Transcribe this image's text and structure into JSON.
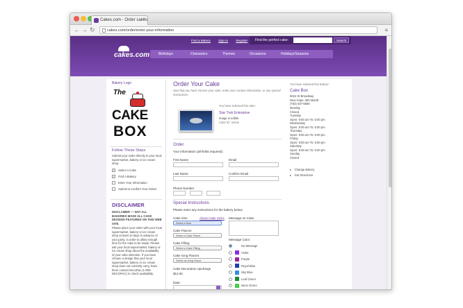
{
  "browser": {
    "tab_title": "Cakes.com - Order cakes",
    "url": "cakes.com/order/enter-your-information"
  },
  "header": {
    "logo_text": "cakes.com",
    "top_links": [
      "Find a Bakery",
      "Sign In",
      "Register"
    ],
    "search_label": "Find the perfect cake:",
    "search_button": "Search",
    "nav": [
      "Birthdays",
      "Characters",
      "Themes",
      "Occasions",
      "Holidays/Seasons"
    ]
  },
  "sidebar": {
    "bakery_logo_label": "Bakery Logo",
    "logo_the": "The",
    "logo_cake": "CAKE",
    "logo_box": "BOX",
    "steps_title": "Follow These Steps",
    "steps_intro": "Submit your order directly to your local supermarket, bakery or ice cream shop.",
    "steps": [
      {
        "label": "Select A Cake",
        "done": true
      },
      {
        "label": "Find A Bakery",
        "done": true
      },
      {
        "label": "Enter Your Information",
        "done": false
      },
      {
        "label": "Submit & Confirm Your Order!",
        "done": false
      }
    ],
    "disclaimer_title": "DISCLAIMER",
    "disclaimer_bold": "DISCLAIMER — NOT ALL BAKERIES MAKE ALL CAKE DESIGNS FEATURED ON THIS WEB SITE.",
    "disclaimer_text": "Please place your order with your local supermarket, bakery or ice cream shop at least 10 days in advance of your party, in order to allow enough time for the cake to be made. Please ask your local supermarket, bakery or ice cream shop about the availability of your cake selection. If you have chosen a design that your local supermarket, bakery or ice cream shop does not currently carry, have them contact DecoPac (1-800-DECOPAC) to check availability."
  },
  "main": {
    "title": "Order Your Cake",
    "intro": "Now that you have chosen your cake, enter your contact information, or any special instructions.",
    "selected_label": "You have selected this cake:",
    "cake_name": "Star Trek Enterprise",
    "cake_note": "Image is edible.",
    "cake_id": "Cake ID: 44442",
    "order_title": "Order",
    "info_required": "Your information (all fields required):",
    "first_name_label": "First Name",
    "email_label": "Email",
    "last_name_label": "Last Name",
    "confirm_email_label": "Confirm Email",
    "phone_label": "Phone Number",
    "special_title": "Special Instructions",
    "special_intro": "Please enter any instructions for the bakery below.",
    "cake_size_label": "Cake Size",
    "about_sizes": "About Cake Sizes",
    "cake_size_value": "Select a Size",
    "message_label": "Message on Cake",
    "cake_flavors_label": "Cake Flavors",
    "cake_flavors_value": "Select a Cake Flavor",
    "cake_filling_label": "Cake Filling",
    "cake_filling_value": "Select a Cake Filling",
    "icing_label": "Cake Icing Flavors",
    "icing_value": "Select an Icing Flavor",
    "upcharge_label": "Cake Decoration Upcharge",
    "upcharge_value": "$12.00",
    "date_label": "Date:",
    "message_color_label": "Message Color",
    "colors": [
      {
        "name": "No Message",
        "hex": ""
      },
      {
        "name": "Violet",
        "hex": "#8a2be2"
      },
      {
        "name": "Purple",
        "hex": "#a020a0"
      },
      {
        "name": "Royal Blue",
        "hex": "#1f3fb0"
      },
      {
        "name": "Sky Blue",
        "hex": "#2f8fe0"
      },
      {
        "name": "Leaf Green",
        "hex": "#1f8a3a"
      },
      {
        "name": "Neon Green",
        "hex": "#46d04a"
      }
    ]
  },
  "bakery": {
    "selected_label": "You have selected this bakery:",
    "name": "Cake Box",
    "address1": "6024 W Broadway",
    "address2": "New Hope, MN 55428",
    "phone": "(763) 537-6580",
    "hours": [
      {
        "day": "Monday",
        "time": "Closed"
      },
      {
        "day": "Tuesday",
        "time": "Open: 9:00 am To: 5:00 pm"
      },
      {
        "day": "Wednesday",
        "time": "Open: 9:00 am To: 5:00 pm"
      },
      {
        "day": "Thursday",
        "time": "Open: 9:00 am To: 5:00 pm"
      },
      {
        "day": "Friday",
        "time": "Open: 9:00 am To: 5:00 pm"
      },
      {
        "day": "Saturday",
        "time": "Open: 9:00 am To: 5:00 pm"
      },
      {
        "day": "Sunday",
        "time": "Closed"
      }
    ],
    "change_link": "Change Bakery",
    "directions_link": "Get Directions"
  }
}
